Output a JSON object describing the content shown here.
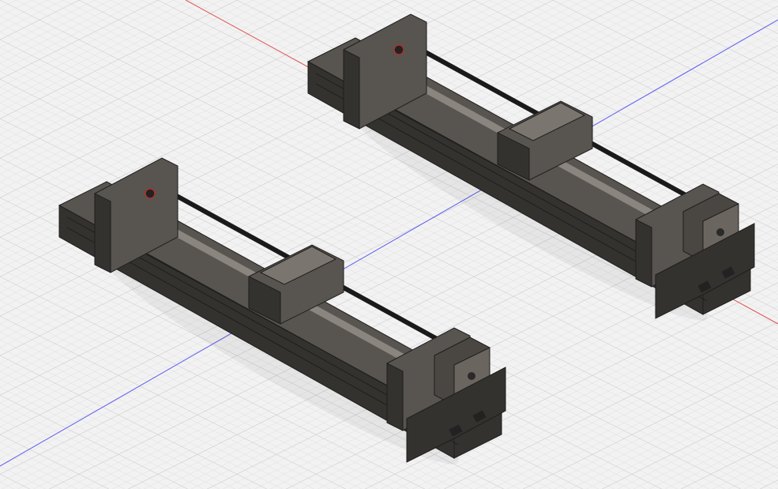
{
  "viewport": {
    "background": "#f2f2f2",
    "grid_minor_color": "#d9d9d9",
    "grid_major_color": "#c4c4c4",
    "x_axis_color": "#e05050",
    "y_axis_color": "#5a5af0"
  },
  "model": {
    "frame_color": "#58544f",
    "frame_dark": "#34322f",
    "frame_light": "#7a756e",
    "rod_color": "#8a857e",
    "motor_color": "#4a4743",
    "edge_color": "#1e1e1e",
    "bearing_accent": "#b03030",
    "assemblies": [
      {
        "name": "linear-actuator-assembly-1",
        "parts": [
          "aluminum-extrusion-rail",
          "end-plate",
          "carriage-block",
          "lead-screw",
          "stepper-motor"
        ]
      },
      {
        "name": "linear-actuator-assembly-2",
        "parts": [
          "aluminum-extrusion-rail",
          "end-plate",
          "carriage-block",
          "lead-screw",
          "stepper-motor"
        ]
      }
    ]
  }
}
